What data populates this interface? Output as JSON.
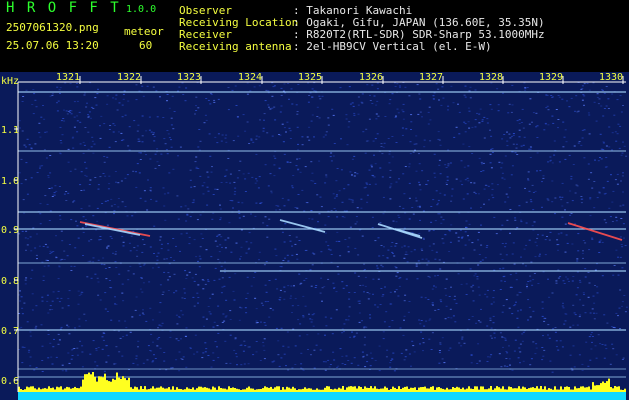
{
  "header": {
    "app_name": "H R O F F T",
    "version": "1.0.0",
    "filename": "2507061320.png",
    "mode_label": "meteor",
    "datetime": "25.07.06 13:20",
    "mode_value": "60",
    "info": [
      {
        "label": "Observer",
        "value": ": Takanori Kawachi"
      },
      {
        "label": "Receiving Location",
        "value": ": Ogaki, Gifu, JAPAN (136.60E, 35.35N)"
      },
      {
        "label": "Receiver",
        "value": ": R820T2(RTL-SDR) SDR-Sharp 53.1000MHz"
      },
      {
        "label": "Receiving antenna",
        "value": ": 2el-HB9CV Vertical (el. E-W)"
      }
    ]
  },
  "spectrogram": {
    "y_unit": "kHz",
    "y_ticks": [
      "1.1",
      "1.0",
      "0.9",
      "0.8",
      "0.7",
      "0.6"
    ],
    "x_ticks": [
      "1321",
      "1322",
      "1323",
      "1324",
      "1325",
      "1326",
      "1327",
      "1328",
      "1329",
      "1330"
    ],
    "colors": {
      "background": "#0a1a5a",
      "noise": "#2a4cd0",
      "line": "#a8d8ff",
      "tick": "#f5ff40",
      "bar_yellow": "#ffff20",
      "bar_cyan": "#10d8ff"
    }
  }
}
